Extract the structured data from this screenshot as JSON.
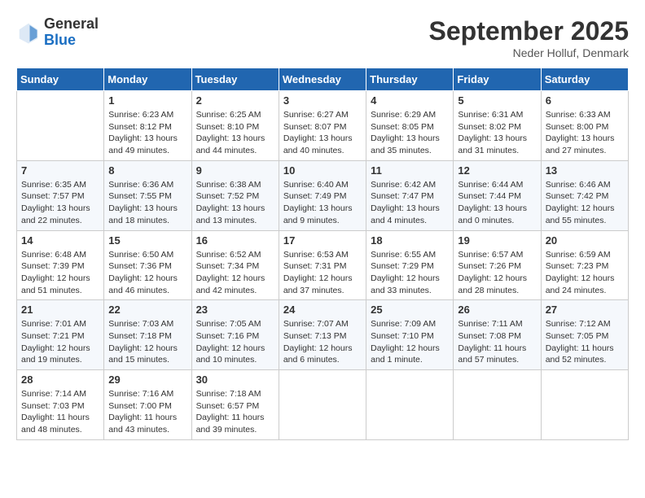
{
  "header": {
    "logo_general": "General",
    "logo_blue": "Blue",
    "month": "September 2025",
    "location": "Neder Holluf, Denmark"
  },
  "days_of_week": [
    "Sunday",
    "Monday",
    "Tuesday",
    "Wednesday",
    "Thursday",
    "Friday",
    "Saturday"
  ],
  "weeks": [
    [
      {
        "day": "",
        "sunrise": "",
        "sunset": "",
        "daylight": ""
      },
      {
        "day": "1",
        "sunrise": "Sunrise: 6:23 AM",
        "sunset": "Sunset: 8:12 PM",
        "daylight": "Daylight: 13 hours and 49 minutes."
      },
      {
        "day": "2",
        "sunrise": "Sunrise: 6:25 AM",
        "sunset": "Sunset: 8:10 PM",
        "daylight": "Daylight: 13 hours and 44 minutes."
      },
      {
        "day": "3",
        "sunrise": "Sunrise: 6:27 AM",
        "sunset": "Sunset: 8:07 PM",
        "daylight": "Daylight: 13 hours and 40 minutes."
      },
      {
        "day": "4",
        "sunrise": "Sunrise: 6:29 AM",
        "sunset": "Sunset: 8:05 PM",
        "daylight": "Daylight: 13 hours and 35 minutes."
      },
      {
        "day": "5",
        "sunrise": "Sunrise: 6:31 AM",
        "sunset": "Sunset: 8:02 PM",
        "daylight": "Daylight: 13 hours and 31 minutes."
      },
      {
        "day": "6",
        "sunrise": "Sunrise: 6:33 AM",
        "sunset": "Sunset: 8:00 PM",
        "daylight": "Daylight: 13 hours and 27 minutes."
      }
    ],
    [
      {
        "day": "7",
        "sunrise": "Sunrise: 6:35 AM",
        "sunset": "Sunset: 7:57 PM",
        "daylight": "Daylight: 13 hours and 22 minutes."
      },
      {
        "day": "8",
        "sunrise": "Sunrise: 6:36 AM",
        "sunset": "Sunset: 7:55 PM",
        "daylight": "Daylight: 13 hours and 18 minutes."
      },
      {
        "day": "9",
        "sunrise": "Sunrise: 6:38 AM",
        "sunset": "Sunset: 7:52 PM",
        "daylight": "Daylight: 13 hours and 13 minutes."
      },
      {
        "day": "10",
        "sunrise": "Sunrise: 6:40 AM",
        "sunset": "Sunset: 7:49 PM",
        "daylight": "Daylight: 13 hours and 9 minutes."
      },
      {
        "day": "11",
        "sunrise": "Sunrise: 6:42 AM",
        "sunset": "Sunset: 7:47 PM",
        "daylight": "Daylight: 13 hours and 4 minutes."
      },
      {
        "day": "12",
        "sunrise": "Sunrise: 6:44 AM",
        "sunset": "Sunset: 7:44 PM",
        "daylight": "Daylight: 13 hours and 0 minutes."
      },
      {
        "day": "13",
        "sunrise": "Sunrise: 6:46 AM",
        "sunset": "Sunset: 7:42 PM",
        "daylight": "Daylight: 12 hours and 55 minutes."
      }
    ],
    [
      {
        "day": "14",
        "sunrise": "Sunrise: 6:48 AM",
        "sunset": "Sunset: 7:39 PM",
        "daylight": "Daylight: 12 hours and 51 minutes."
      },
      {
        "day": "15",
        "sunrise": "Sunrise: 6:50 AM",
        "sunset": "Sunset: 7:36 PM",
        "daylight": "Daylight: 12 hours and 46 minutes."
      },
      {
        "day": "16",
        "sunrise": "Sunrise: 6:52 AM",
        "sunset": "Sunset: 7:34 PM",
        "daylight": "Daylight: 12 hours and 42 minutes."
      },
      {
        "day": "17",
        "sunrise": "Sunrise: 6:53 AM",
        "sunset": "Sunset: 7:31 PM",
        "daylight": "Daylight: 12 hours and 37 minutes."
      },
      {
        "day": "18",
        "sunrise": "Sunrise: 6:55 AM",
        "sunset": "Sunset: 7:29 PM",
        "daylight": "Daylight: 12 hours and 33 minutes."
      },
      {
        "day": "19",
        "sunrise": "Sunrise: 6:57 AM",
        "sunset": "Sunset: 7:26 PM",
        "daylight": "Daylight: 12 hours and 28 minutes."
      },
      {
        "day": "20",
        "sunrise": "Sunrise: 6:59 AM",
        "sunset": "Sunset: 7:23 PM",
        "daylight": "Daylight: 12 hours and 24 minutes."
      }
    ],
    [
      {
        "day": "21",
        "sunrise": "Sunrise: 7:01 AM",
        "sunset": "Sunset: 7:21 PM",
        "daylight": "Daylight: 12 hours and 19 minutes."
      },
      {
        "day": "22",
        "sunrise": "Sunrise: 7:03 AM",
        "sunset": "Sunset: 7:18 PM",
        "daylight": "Daylight: 12 hours and 15 minutes."
      },
      {
        "day": "23",
        "sunrise": "Sunrise: 7:05 AM",
        "sunset": "Sunset: 7:16 PM",
        "daylight": "Daylight: 12 hours and 10 minutes."
      },
      {
        "day": "24",
        "sunrise": "Sunrise: 7:07 AM",
        "sunset": "Sunset: 7:13 PM",
        "daylight": "Daylight: 12 hours and 6 minutes."
      },
      {
        "day": "25",
        "sunrise": "Sunrise: 7:09 AM",
        "sunset": "Sunset: 7:10 PM",
        "daylight": "Daylight: 12 hours and 1 minute."
      },
      {
        "day": "26",
        "sunrise": "Sunrise: 7:11 AM",
        "sunset": "Sunset: 7:08 PM",
        "daylight": "Daylight: 11 hours and 57 minutes."
      },
      {
        "day": "27",
        "sunrise": "Sunrise: 7:12 AM",
        "sunset": "Sunset: 7:05 PM",
        "daylight": "Daylight: 11 hours and 52 minutes."
      }
    ],
    [
      {
        "day": "28",
        "sunrise": "Sunrise: 7:14 AM",
        "sunset": "Sunset: 7:03 PM",
        "daylight": "Daylight: 11 hours and 48 minutes."
      },
      {
        "day": "29",
        "sunrise": "Sunrise: 7:16 AM",
        "sunset": "Sunset: 7:00 PM",
        "daylight": "Daylight: 11 hours and 43 minutes."
      },
      {
        "day": "30",
        "sunrise": "Sunrise: 7:18 AM",
        "sunset": "Sunset: 6:57 PM",
        "daylight": "Daylight: 11 hours and 39 minutes."
      },
      {
        "day": "",
        "sunrise": "",
        "sunset": "",
        "daylight": ""
      },
      {
        "day": "",
        "sunrise": "",
        "sunset": "",
        "daylight": ""
      },
      {
        "day": "",
        "sunrise": "",
        "sunset": "",
        "daylight": ""
      },
      {
        "day": "",
        "sunrise": "",
        "sunset": "",
        "daylight": ""
      }
    ]
  ]
}
